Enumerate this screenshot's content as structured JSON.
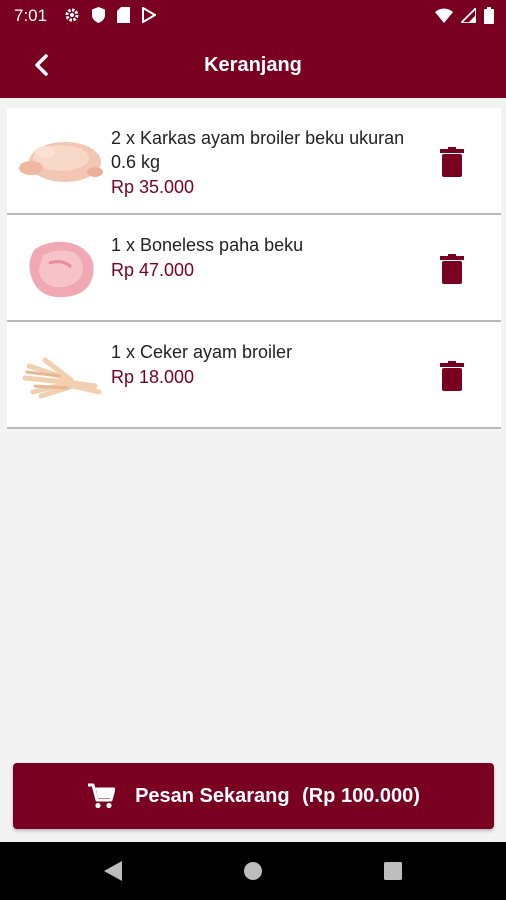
{
  "status_bar": {
    "time": "7:01",
    "left_icons": [
      "gear-icon",
      "shield-icon",
      "sd-card-icon",
      "play-store-icon"
    ],
    "right_icons": [
      "wifi-icon",
      "signal-icon",
      "battery-icon"
    ]
  },
  "app_bar": {
    "title": "Keranjang",
    "back_icon": "chevron-left-icon"
  },
  "cart": {
    "items": [
      {
        "name": "2 x Karkas ayam broiler beku ukuran 0.6 kg",
        "price": "Rp 35.000",
        "image": "whole-chicken-image"
      },
      {
        "name": "1 x Boneless paha beku",
        "price": "Rp 47.000",
        "image": "boneless-thigh-image"
      },
      {
        "name": "1 x Ceker ayam broiler",
        "price": "Rp 18.000",
        "image": "chicken-feet-image"
      }
    ]
  },
  "order_button": {
    "label": "Pesan Sekarang",
    "total": "(Rp 100.000)",
    "icon": "cart-icon"
  },
  "colors": {
    "primary": "#7a0022",
    "background": "#f3f3f3",
    "divider": "#b9b9b9"
  }
}
